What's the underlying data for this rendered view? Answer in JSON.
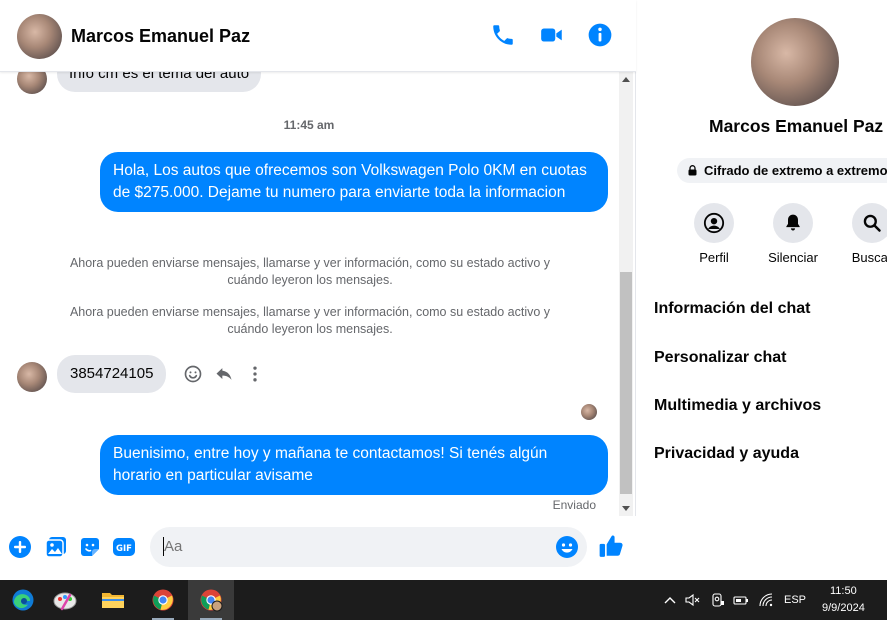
{
  "contact": {
    "name": "Marcos Emanuel Paz"
  },
  "messages": {
    "prev_in": "Info cm es el tema del auto",
    "timestamp": "11:45 am",
    "out1": "Hola, Los autos que ofrecemos son Volkswagen Polo 0KM en cuotas de $275.000. Dejame tu numero para enviarte toda la informacion",
    "system1": "Ahora pueden enviarse mensajes, llamarse y ver información, como su estado activo y cuándo leyeron los mensajes.",
    "system2": "Ahora pueden enviarse mensajes, llamarse y ver información, como su estado activo y cuándo leyeron los mensajes.",
    "in_phone": "3854724105",
    "out2": "Buenisimo, entre hoy y mañana te contactamos! Si tenés algún horario en particular avisame",
    "sent_status": "Enviado"
  },
  "composer": {
    "placeholder": "Aa"
  },
  "info_panel": {
    "name": "Marcos Emanuel Paz",
    "encryption": "Cifrado de extremo a extremo",
    "actions": [
      {
        "label": "Perfil",
        "icon": "profile-icon"
      },
      {
        "label": "Silenciar",
        "icon": "bell-icon"
      },
      {
        "label": "Buscar",
        "icon": "search-icon"
      }
    ],
    "menu": [
      {
        "label": "Información del chat"
      },
      {
        "label": "Personalizar chat"
      },
      {
        "label": "Multimedia y archivos"
      },
      {
        "label": "Privacidad y ayuda"
      }
    ]
  },
  "taskbar": {
    "language": "ESP",
    "time": "11:50",
    "date": "9/9/2024"
  },
  "colors": {
    "accent": "#0084ff",
    "incoming_bubble": "#e4e6eb",
    "taskbar": "#1c1c1c"
  }
}
